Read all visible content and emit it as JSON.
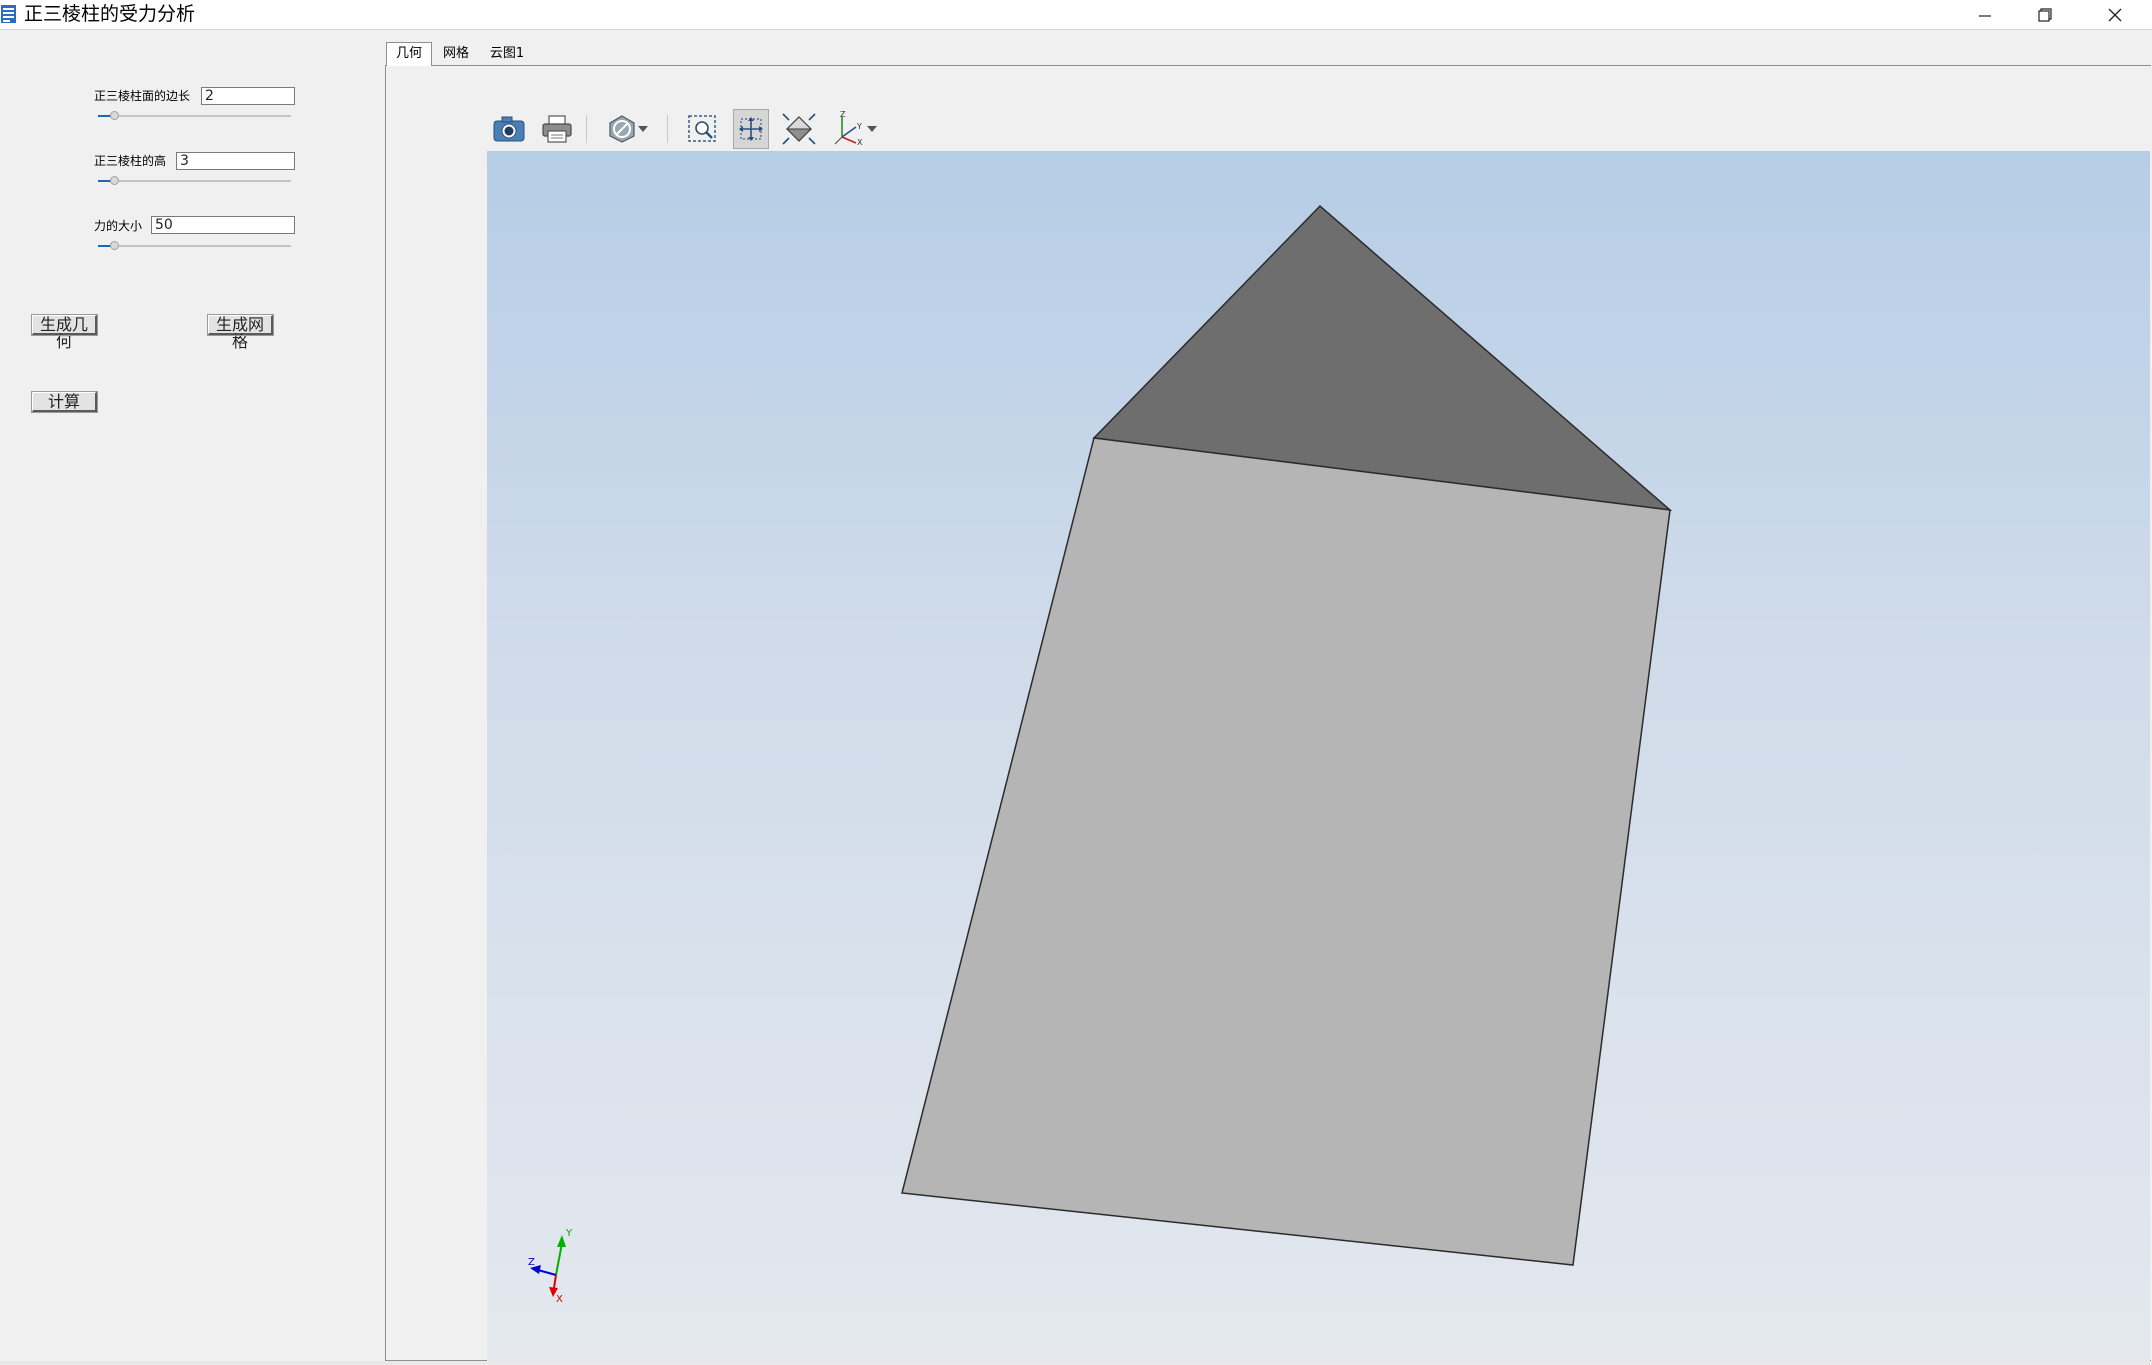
{
  "window": {
    "title": "正三棱柱的受力分析",
    "controls": [
      "minimize-icon",
      "restore-icon",
      "close-icon"
    ]
  },
  "params": [
    {
      "label": "正三棱柱面的边长",
      "value": "2",
      "slider_fraction": 0.12
    },
    {
      "label": "正三棱柱的高",
      "value": "3",
      "slider_fraction": 0.12
    },
    {
      "label": "力的大小",
      "value": "50",
      "slider_fraction": 0.12
    }
  ],
  "buttons": {
    "geometry": "生成几何",
    "mesh": "生成网格",
    "compute": "计算"
  },
  "tabs": [
    {
      "label": "几何",
      "active": true
    },
    {
      "label": "网格",
      "active": false
    },
    {
      "label": "云图1",
      "active": false
    }
  ],
  "toolbar": {
    "items": [
      "camera-icon",
      "print-icon",
      "display-mode-icon",
      "zoom-box-icon",
      "pan-icon",
      "fit-view-icon",
      "axes-orientation-icon"
    ],
    "pressed": "pan-icon"
  },
  "viewport": {
    "background_top": "#b6cde6",
    "background_bottom": "#e4e8ee",
    "top_face_color": "#6e6e6e",
    "side_face_color": "#b5b5b5",
    "triad": {
      "x_color": "#e00000",
      "y_color": "#00b000",
      "z_color": "#0000d0",
      "x": "X",
      "y": "Y",
      "z": "Z"
    }
  }
}
